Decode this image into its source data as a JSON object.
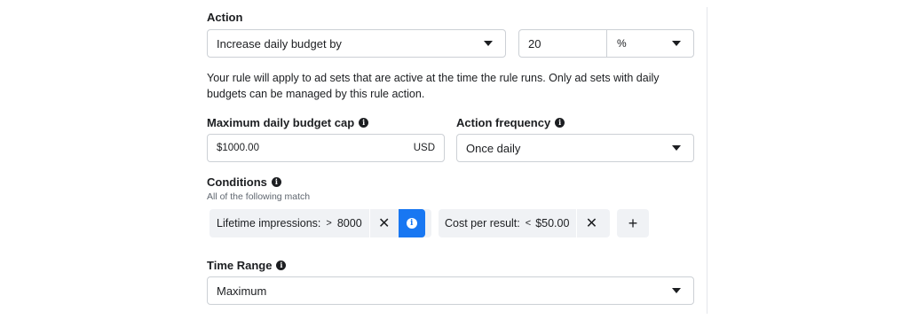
{
  "action": {
    "label": "Action",
    "select_value": "Increase daily budget by",
    "amount_value": "20",
    "unit_value": "%"
  },
  "help_text": "Your rule will apply to ad sets that are active at the time the rule runs. Only ad sets with daily budgets can be managed by this rule action.",
  "budget_cap": {
    "label": "Maximum daily budget cap",
    "value": "$1000.00",
    "currency": "USD"
  },
  "frequency": {
    "label": "Action frequency",
    "value": "Once daily"
  },
  "conditions": {
    "label": "Conditions",
    "sublabel": "All of the following match",
    "items": [
      {
        "text": "Lifetime impressions:",
        "operator": ">",
        "value": "8000"
      },
      {
        "text": "Cost per result:",
        "operator": "<",
        "value": "$50.00"
      }
    ]
  },
  "time_range": {
    "label": "Time Range",
    "value": "Maximum"
  },
  "icons": {
    "info": "i",
    "close": "✕",
    "add": "+"
  }
}
